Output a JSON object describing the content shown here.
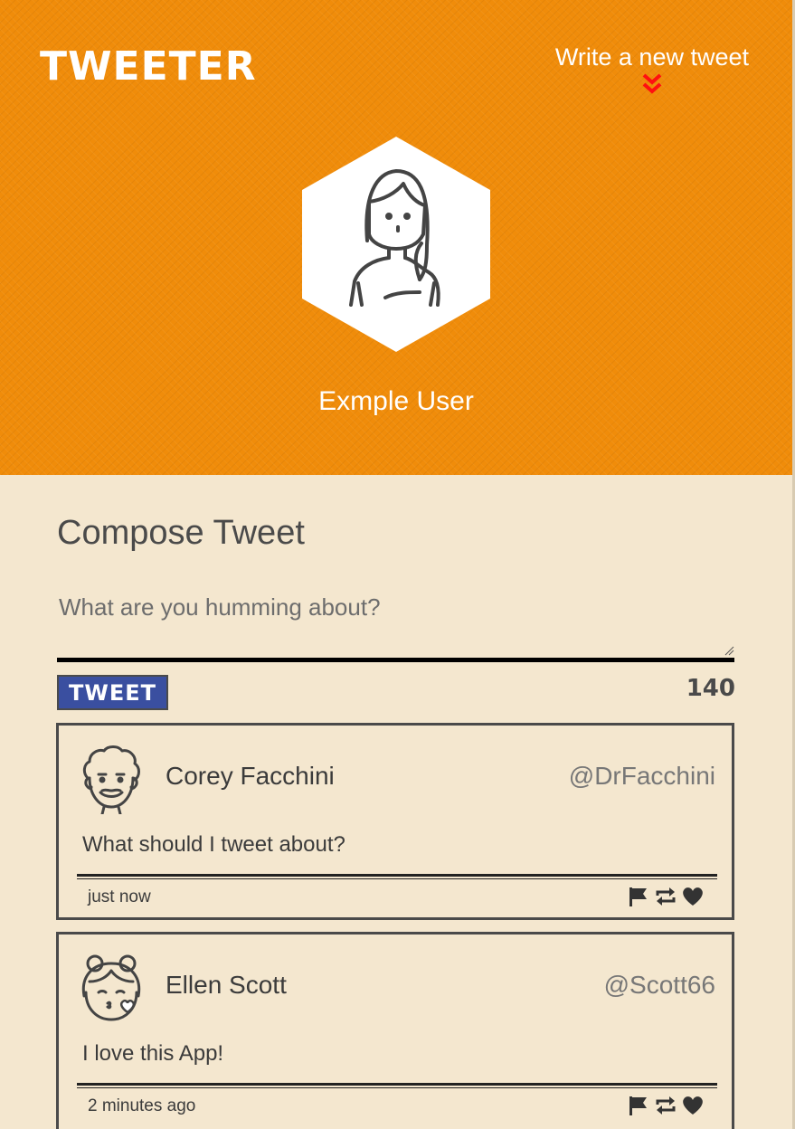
{
  "header": {
    "brand": "TWEETER",
    "new_tweet_label": "Write a new tweet",
    "profile_name": "Exmple User"
  },
  "compose": {
    "title": "Compose Tweet",
    "placeholder": "What are you humming about?",
    "button_label": "TWEET",
    "counter": "140"
  },
  "tweets": [
    {
      "name": "Corey Facchini",
      "handle": "@DrFacchini",
      "text": "What should I tweet about?",
      "time": "just now"
    },
    {
      "name": "Ellen Scott",
      "handle": "@Scott66",
      "text": "I love this App!",
      "time": "2 minutes ago"
    }
  ],
  "icons": {
    "new_tweet": "double-chevron-down-icon",
    "actions": [
      "flag-icon",
      "retweet-icon",
      "heart-icon"
    ]
  },
  "colors": {
    "header_bg": "#f08c0a",
    "page_bg": "#f4e7cf",
    "button_bg": "#3a4fa0",
    "chevron": "#ff0000",
    "text": "#4a4a4a"
  }
}
